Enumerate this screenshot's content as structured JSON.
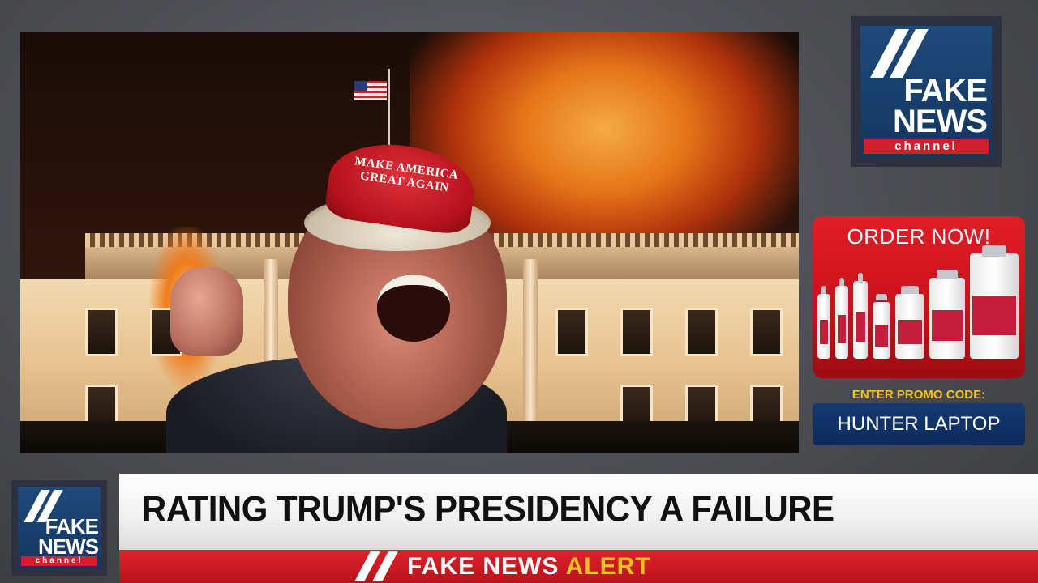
{
  "video": {
    "cap_text": "MAKE AMERICA GREAT AGAIN"
  },
  "logo": {
    "word1": "FAKE",
    "word2": "NEWS",
    "channel": "channel"
  },
  "ad": {
    "title": "ORDER NOW!",
    "promo_label": "ENTER PROMO CODE:",
    "promo_code": "HUNTER LAPTOP"
  },
  "lower_third": {
    "headline": "RATING TRUMP'S PRESIDENCY A FAILURE",
    "alert_prefix": "FAKE NEWS",
    "alert_suffix": "ALERT"
  },
  "colors": {
    "brand_red": "#d2202a",
    "brand_blue": "#1f4a7c",
    "promo_yellow": "#f5c21b"
  }
}
